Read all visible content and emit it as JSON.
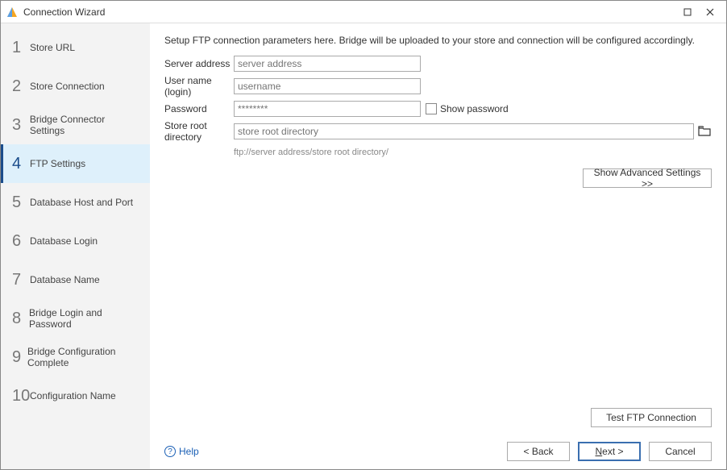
{
  "window": {
    "title": "Connection Wizard"
  },
  "sidebar": {
    "steps": [
      {
        "num": "1",
        "label": "Store URL"
      },
      {
        "num": "2",
        "label": "Store Connection"
      },
      {
        "num": "3",
        "label": "Bridge Connector Settings"
      },
      {
        "num": "4",
        "label": "FTP Settings"
      },
      {
        "num": "5",
        "label": "Database Host and Port"
      },
      {
        "num": "6",
        "label": "Database Login"
      },
      {
        "num": "7",
        "label": "Database Name"
      },
      {
        "num": "8",
        "label": "Bridge Login and Password"
      },
      {
        "num": "9",
        "label": "Bridge Configuration Complete"
      },
      {
        "num": "10",
        "label": "Configuration Name"
      }
    ],
    "active_index": 3
  },
  "main": {
    "description": "Setup FTP connection parameters here. Bridge will be uploaded to your store and connection will be configured accordingly.",
    "fields": {
      "server_address": {
        "label": "Server address",
        "placeholder": "server address",
        "value": ""
      },
      "username": {
        "label": "User name (login)",
        "placeholder": "username",
        "value": ""
      },
      "password": {
        "label": "Password",
        "placeholder": "********",
        "value": ""
      },
      "show_password": {
        "label": "Show password",
        "checked": false
      },
      "store_root": {
        "label": "Store root directory",
        "placeholder": "store root directory",
        "value": ""
      }
    },
    "hint": "ftp://server address/store root directory/",
    "advanced_button": "Show Advanced Settings >>",
    "test_button": "Test FTP Connection"
  },
  "footer": {
    "help": "Help",
    "back": "< Back",
    "next": "Next >",
    "cancel": "Cancel"
  }
}
